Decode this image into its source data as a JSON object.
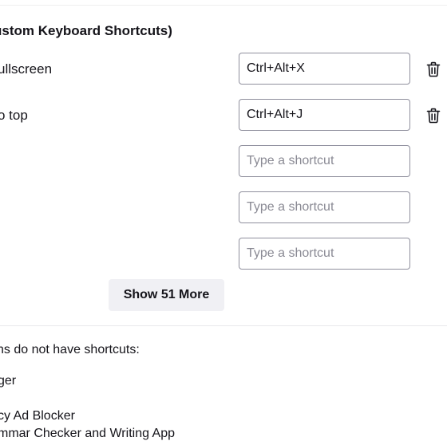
{
  "section": {
    "title": "ustom Keyboard Shortcuts)"
  },
  "shortcuts": [
    {
      "label": "ullscreen",
      "value": "Ctrl+Alt+X",
      "placeholder": "Type a shortcut"
    },
    {
      "label": "o top",
      "value": "Ctrl+Alt+J",
      "placeholder": "Type a shortcut"
    },
    {
      "label": "",
      "value": "",
      "placeholder": "Type a shortcut"
    },
    {
      "label": "",
      "value": "",
      "placeholder": "Type a shortcut"
    },
    {
      "label": "",
      "value": "",
      "placeholder": "Type a shortcut"
    }
  ],
  "show_more_label": "Show 51 More",
  "no_shortcuts": {
    "note": "ns do not have shortcuts:",
    "items": [
      "ger",
      "cy Ad Blocker",
      "mmar Checker and Writing App"
    ]
  },
  "icons": {
    "remove": "trash-icon"
  },
  "colors": {
    "input_border": "#8f8f9d",
    "button_bg": "#f0f0f4",
    "text": "#15141a"
  }
}
